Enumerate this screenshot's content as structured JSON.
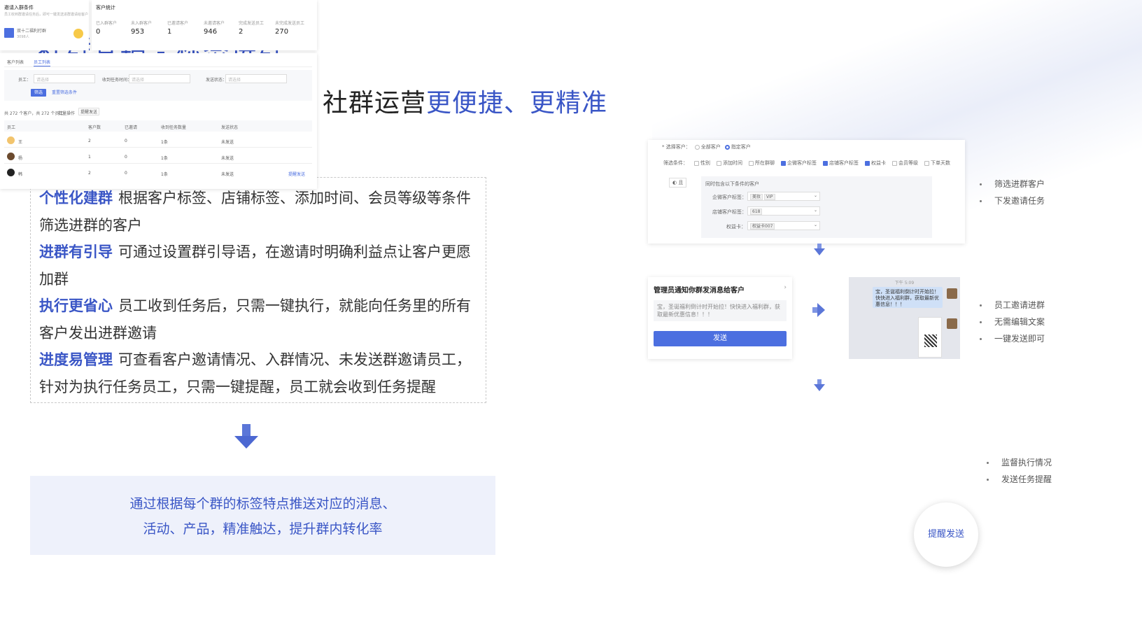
{
  "title": "社群营销 - 标签进群",
  "subtitle": {
    "plain": "根据客户标签一键拉群，社群运营",
    "highlight": "更便捷、更精准"
  },
  "features": [
    {
      "title": "个性化建群",
      "text": "根据客户标签、店铺标签、添加时间、会员等级等条件筛选进群的客户"
    },
    {
      "title": "进群有引导",
      "text": "可通过设置群引导语，在邀请时明确利益点让客户更愿加群"
    },
    {
      "title": "执行更省心",
      "text": "员工收到任务后，只需一键执行，就能向任务里的所有客户发出进群邀请"
    },
    {
      "title": "进度易管理",
      "text": "可查看客户邀请情况、入群情况、未发送群邀请员工，针对为执行任务员工，只需一键提醒，员工就会收到任务提醒"
    }
  ],
  "summary": {
    "line1": "通过根据每个群的标签特点推送对应的消息、",
    "line2": "活动、产品，精准触达，提升群内转化率"
  },
  "step1": {
    "select_label": "* 选择客户：",
    "opt_all": "全部客户",
    "opt_specified": "指定客户",
    "filter_label": "筛选条件：",
    "filters": [
      {
        "label": "性别",
        "checked": false
      },
      {
        "label": "添加时间",
        "checked": false
      },
      {
        "label": "所在群聊",
        "checked": false
      },
      {
        "label": "企微客户标签",
        "checked": true
      },
      {
        "label": "店铺客户标签",
        "checked": true
      },
      {
        "label": "权益卡",
        "checked": true
      },
      {
        "label": "会员等级",
        "checked": false
      },
      {
        "label": "下单天数",
        "checked": false
      }
    ],
    "logic": "且",
    "cond_title": "同时包含以下条件的客户",
    "conds": [
      {
        "label": "企微客户标签：",
        "tags": [
          "美妆",
          "VIP"
        ]
      },
      {
        "label": "店铺客户标签：",
        "tags": [
          "618"
        ]
      },
      {
        "label": "权益卡：",
        "tags": [
          "权益卡007"
        ]
      }
    ],
    "bullets": [
      "筛选进群客户",
      "下发邀请任务"
    ]
  },
  "step2": {
    "title": "管理员通知你群发消息给客户",
    "message": "宝，圣诞福利倒计时开始拉！快快进入福利群，获取最新优惠信息！！！",
    "send_label": "发送",
    "chat_time": "下午 5:09",
    "chat_bubble": "宝，圣诞福利倒计时开始拉！快快进入福利群，获取最新优惠信息！！！",
    "bullets": [
      "员工邀请进群",
      "无需编辑文案",
      "一键发送即可"
    ]
  },
  "step3": {
    "cond_title": "邀请入群条件",
    "cond_desc": "员工收到群邀请任务后，即可一键发送进群邀请给客户",
    "group_name": "双十二福利打群",
    "group_sub": "3098人",
    "stats_title": "客户统计",
    "stats": [
      {
        "label": "已入群客户",
        "value": "0"
      },
      {
        "label": "未入群客户",
        "value": "953"
      },
      {
        "label": "已邀请客户",
        "value": "1"
      },
      {
        "label": "未邀请客户",
        "value": "946"
      },
      {
        "label": "完成发送员工",
        "value": "2"
      },
      {
        "label": "未完成发送员工",
        "value": "270"
      }
    ],
    "tabs": [
      "客户列表",
      "员工列表"
    ],
    "f_staff": "员工：",
    "f_time": "收到任务时间：",
    "f_status": "发送状态：",
    "placeholder": "请选择",
    "filter_btn": "筛选",
    "reset_btn": "重置筛选条件",
    "summary_text": "共 272 个客户，共 272 个员工",
    "batch": "批量操作",
    "remind_btn": "提醒发送",
    "headers": [
      "员工",
      "客户数",
      "已邀请",
      "收到任务数量",
      "发送状态"
    ],
    "rows": [
      {
        "name": "王",
        "customers": "2",
        "invited": "0",
        "tasks": "1条",
        "status": "未发送"
      },
      {
        "name": "杨",
        "customers": "1",
        "invited": "0",
        "tasks": "1条",
        "status": "未发送"
      },
      {
        "name": "韩",
        "customers": "2",
        "invited": "0",
        "tasks": "1条",
        "status": "未发送"
      }
    ],
    "row_action": "提醒发送",
    "magnified": "提醒发送",
    "bullets": [
      "监督执行情况",
      "发送任务提醒"
    ]
  },
  "colors": {
    "accent": "#3a56c6",
    "button": "#4c6fe0",
    "summary_bg": "#eef1fb"
  }
}
